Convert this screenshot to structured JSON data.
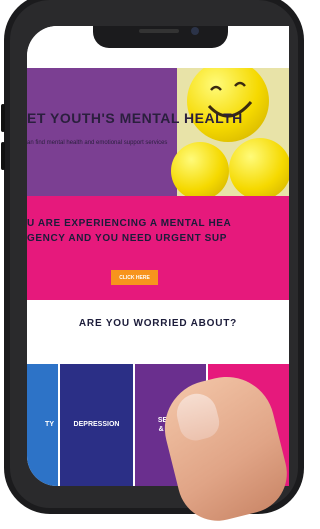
{
  "hero": {
    "title": "ET YOUTH'S MENTAL HEALTH",
    "subtitle": "an find mental health and emotional support services"
  },
  "urgent": {
    "line1": "U ARE EXPERIENCING A MENTAL HEA",
    "line2": "GENCY AND YOU NEED URGENT SUP",
    "button_label": "CLICK HERE"
  },
  "worried": {
    "heading": "ARE YOU WORRIED ABOUT?",
    "cards": [
      {
        "label": "TY",
        "color": "#2d73c7"
      },
      {
        "label": "DEPRESSION",
        "color": "#2b2f86"
      },
      {
        "label_line1": "SELF-H",
        "label_line2": "& SUIC",
        "color": "#6a2f8e"
      },
      {
        "label": "",
        "color": "#e6197c"
      }
    ]
  },
  "colors": {
    "hero_bg": "#7b3f92",
    "urgent_bg": "#e6197c",
    "button_bg": "#f7941d",
    "heading_text": "#1c1c3a"
  }
}
